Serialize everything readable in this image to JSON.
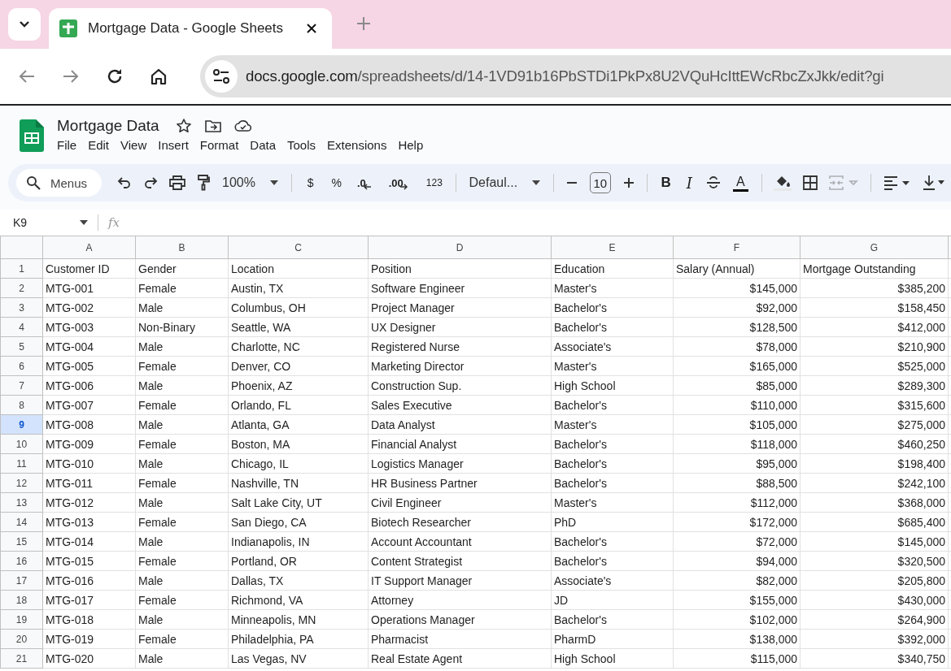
{
  "browser": {
    "tab": {
      "title": "Mortgage Data - Google Sheets"
    },
    "url_host": "docs.google.com",
    "url_path": "/spreadsheets/d/14-1VD91b16PbSTDi1PkPx8U2VQuHcIttEWcRbcZxJkk/edit?gi"
  },
  "document": {
    "title": "Mortgage Data"
  },
  "menu": [
    "File",
    "Edit",
    "View",
    "Insert",
    "Format",
    "Data",
    "Tools",
    "Extensions",
    "Help"
  ],
  "toolbar": [
    [
      {
        "kind": "search",
        "label": "Menus",
        "disabled": false
      },
      {
        "kind": "undo",
        "disabled": false
      },
      {
        "kind": "redo",
        "disabled": false
      },
      {
        "kind": "print",
        "disabled": false
      },
      {
        "kind": "paint",
        "disabled": false
      },
      {
        "kind": "dropdown",
        "label": "100%",
        "disabled": false
      }
    ],
    [
      {
        "kind": "text",
        "label": "$",
        "disabled": false
      },
      {
        "kind": "text",
        "label": "%",
        "disabled": false
      },
      {
        "kind": "decimal-less",
        "label": ".0",
        "disabled": false
      },
      {
        "kind": "decimal-more",
        "label": ".00",
        "disabled": false
      },
      {
        "kind": "small-text",
        "label": "123",
        "disabled": false
      }
    ],
    [
      {
        "kind": "dropdown",
        "label": "Defaul...",
        "disabled": false
      }
    ],
    [
      {
        "kind": "minus",
        "disabled": false
      },
      {
        "kind": "size",
        "label": "10",
        "disabled": false
      },
      {
        "kind": "plus",
        "disabled": false
      }
    ],
    [
      {
        "kind": "bold",
        "label": "B",
        "disabled": false
      },
      {
        "kind": "italic",
        "label": "I",
        "disabled": false
      },
      {
        "kind": "strike",
        "disabled": false
      },
      {
        "kind": "color",
        "label": "A",
        "disabled": false
      }
    ],
    [
      {
        "kind": "fill",
        "disabled": false
      },
      {
        "kind": "borders",
        "disabled": false
      },
      {
        "kind": "merge",
        "disabled": true
      }
    ],
    [
      {
        "kind": "align",
        "disabled": false
      },
      {
        "kind": "valign",
        "disabled": false
      }
    ]
  ],
  "formula_bar": {
    "cell": "K9",
    "fx": "fx"
  },
  "columns": [
    {
      "letter": "A",
      "kind": "text"
    },
    {
      "letter": "B",
      "kind": "text"
    },
    {
      "letter": "C",
      "kind": "text"
    },
    {
      "letter": "D",
      "kind": "text"
    },
    {
      "letter": "E",
      "kind": "text"
    },
    {
      "letter": "F",
      "kind": "number"
    },
    {
      "letter": "G",
      "kind": "number"
    }
  ],
  "rows": [
    {
      "number": "1",
      "selected": false,
      "cells": [
        "Customer ID",
        "Gender",
        "Location",
        "Position",
        "Education",
        "Salary (Annual)",
        "Mortgage Outstanding"
      ],
      "header": true
    },
    {
      "number": "2",
      "selected": false,
      "cells": [
        "MTG-001",
        "Female",
        "Austin, TX",
        "Software Engineer",
        "Master's",
        "$145,000",
        "$385,200"
      ],
      "header": false
    },
    {
      "number": "3",
      "selected": false,
      "cells": [
        "MTG-002",
        "Male",
        "Columbus, OH",
        "Project Manager",
        "Bachelor's",
        "$92,000",
        "$158,450"
      ],
      "header": false
    },
    {
      "number": "4",
      "selected": false,
      "cells": [
        "MTG-003",
        "Non-Binary",
        "Seattle, WA",
        "UX Designer",
        "Bachelor's",
        "$128,500",
        "$412,000"
      ],
      "header": false
    },
    {
      "number": "5",
      "selected": false,
      "cells": [
        "MTG-004",
        "Male",
        "Charlotte, NC",
        "Registered Nurse",
        "Associate's",
        "$78,000",
        "$210,900"
      ],
      "header": false
    },
    {
      "number": "6",
      "selected": false,
      "cells": [
        "MTG-005",
        "Female",
        "Denver, CO",
        "Marketing Director",
        "Master's",
        "$165,000",
        "$525,000"
      ],
      "header": false
    },
    {
      "number": "7",
      "selected": false,
      "cells": [
        "MTG-006",
        "Male",
        "Phoenix, AZ",
        "Construction Sup.",
        "High School",
        "$85,000",
        "$289,300"
      ],
      "header": false
    },
    {
      "number": "8",
      "selected": false,
      "cells": [
        "MTG-007",
        "Female",
        "Orlando, FL",
        "Sales Executive",
        "Bachelor's",
        "$110,000",
        "$315,600"
      ],
      "header": false
    },
    {
      "number": "9",
      "selected": true,
      "cells": [
        "MTG-008",
        "Male",
        "Atlanta, GA",
        "Data Analyst",
        "Master's",
        "$105,000",
        "$275,000"
      ],
      "header": false
    },
    {
      "number": "10",
      "selected": false,
      "cells": [
        "MTG-009",
        "Female",
        "Boston, MA",
        "Financial Analyst",
        "Bachelor's",
        "$118,000",
        "$460,250"
      ],
      "header": false
    },
    {
      "number": "11",
      "selected": false,
      "cells": [
        "MTG-010",
        "Male",
        "Chicago, IL",
        "Logistics Manager",
        "Bachelor's",
        "$95,000",
        "$198,400"
      ],
      "header": false
    },
    {
      "number": "12",
      "selected": false,
      "cells": [
        "MTG-011",
        "Female",
        "Nashville, TN",
        "HR Business Partner",
        "Bachelor's",
        "$88,500",
        "$242,100"
      ],
      "header": false
    },
    {
      "number": "13",
      "selected": false,
      "cells": [
        "MTG-012",
        "Male",
        "Salt Lake City, UT",
        "Civil Engineer",
        "Master's",
        "$112,000",
        "$368,000"
      ],
      "header": false
    },
    {
      "number": "14",
      "selected": false,
      "cells": [
        "MTG-013",
        "Female",
        "San Diego, CA",
        "Biotech Researcher",
        "PhD",
        "$172,000",
        "$685,400"
      ],
      "header": false
    },
    {
      "number": "15",
      "selected": false,
      "cells": [
        "MTG-014",
        "Male",
        "Indianapolis, IN",
        "Account Accountant",
        "Bachelor's",
        "$72,000",
        "$145,000"
      ],
      "header": false
    },
    {
      "number": "16",
      "selected": false,
      "cells": [
        "MTG-015",
        "Female",
        "Portland, OR",
        "Content Strategist",
        "Bachelor's",
        "$94,000",
        "$320,500"
      ],
      "header": false
    },
    {
      "number": "17",
      "selected": false,
      "cells": [
        "MTG-016",
        "Male",
        "Dallas, TX",
        "IT Support Manager",
        "Associate's",
        "$82,000",
        "$205,800"
      ],
      "header": false
    },
    {
      "number": "18",
      "selected": false,
      "cells": [
        "MTG-017",
        "Female",
        "Richmond, VA",
        "Attorney",
        "JD",
        "$155,000",
        "$430,000"
      ],
      "header": false
    },
    {
      "number": "19",
      "selected": false,
      "cells": [
        "MTG-018",
        "Male",
        "Minneapolis, MN",
        "Operations Manager",
        "Bachelor's",
        "$102,000",
        "$264,900"
      ],
      "header": false
    },
    {
      "number": "20",
      "selected": false,
      "cells": [
        "MTG-019",
        "Female",
        "Philadelphia, PA",
        "Pharmacist",
        "PharmD",
        "$138,000",
        "$392,000"
      ],
      "header": false
    },
    {
      "number": "21",
      "selected": false,
      "cells": [
        "MTG-020",
        "Male",
        "Las Vegas, NV",
        "Real Estate Agent",
        "High School",
        "$115,000",
        "$340,750"
      ],
      "header": false
    }
  ]
}
